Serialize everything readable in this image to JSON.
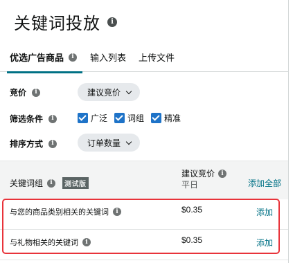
{
  "page": {
    "title": "关键词投放"
  },
  "tabs": [
    {
      "label": "优选广告商品",
      "active": true
    },
    {
      "label": "输入列表",
      "active": false
    },
    {
      "label": "上传文件",
      "active": false
    }
  ],
  "bid": {
    "label": "竞价",
    "selected": "建议竞价"
  },
  "filter": {
    "label": "筛选条件",
    "options": [
      {
        "label": "广泛",
        "checked": true
      },
      {
        "label": "词组",
        "checked": true
      },
      {
        "label": "精准",
        "checked": true
      }
    ]
  },
  "sort": {
    "label": "排序方式",
    "selected": "订单数量"
  },
  "table": {
    "header": {
      "keyword_group": "关键词组",
      "beta_badge": "测试版",
      "suggested_bid": "建议竞价",
      "suggested_bid_sub": "平日",
      "add_all": "添加全部"
    },
    "rows": [
      {
        "keyword": "与您的商品类别相关的关键词",
        "bid": "$0.35",
        "action": "添加"
      },
      {
        "keyword": "与礼物相关的关键词",
        "bid": "$0.35",
        "action": "添加"
      }
    ]
  },
  "colors": {
    "accent": "#007185",
    "checkbox": "#1e73c8",
    "highlight": "#e8333a"
  }
}
